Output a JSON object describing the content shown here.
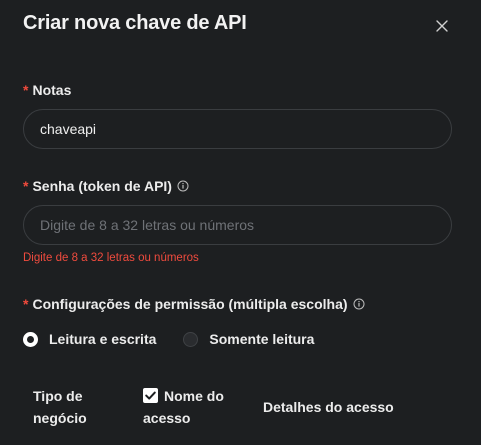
{
  "dialog": {
    "title": "Criar nova chave de API"
  },
  "notes": {
    "required_mark": "*",
    "label": "Notas",
    "value": "chaveapi"
  },
  "password": {
    "required_mark": "*",
    "label": "Senha (token de API)",
    "placeholder": "Digite de 8 a 32 letras ou números",
    "error": "Digite de 8 a 32 letras ou números"
  },
  "permissions": {
    "required_mark": "*",
    "label": "Configurações de permissão (múltipla escolha)",
    "options": [
      {
        "label": "Leitura e escrita",
        "selected": true
      },
      {
        "label": "Somente leitura",
        "selected": false
      }
    ]
  },
  "table": {
    "col_business_type": "Tipo de negócio",
    "col_access_name": "Nome do acesso",
    "col_access_name_checked": true,
    "col_access_details": "Detalhes do acesso"
  },
  "colors": {
    "background": "#1d1f21",
    "required": "#f04a3c",
    "error": "#ef4b3e",
    "input_border": "#3a3d40"
  }
}
